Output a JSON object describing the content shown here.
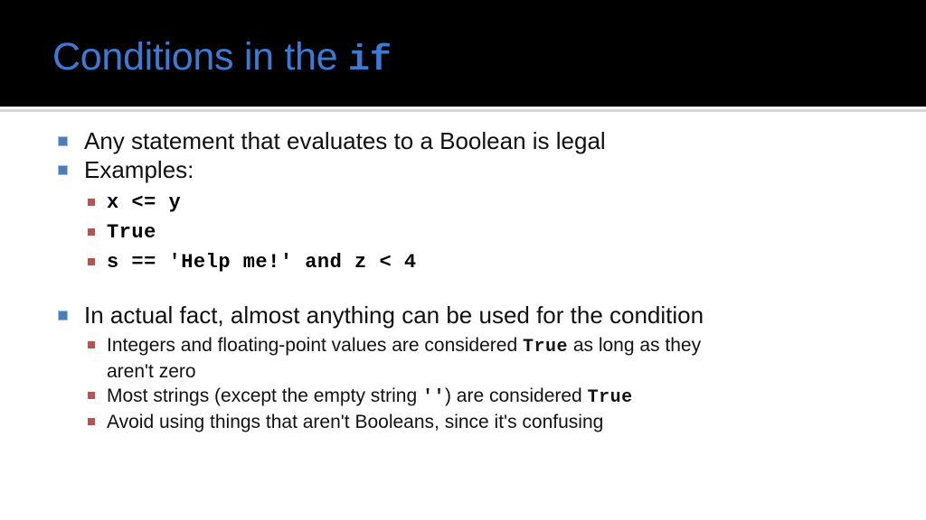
{
  "slide": {
    "title_prefix": "Conditions in the ",
    "title_code": "if",
    "title_color": "#3c7ad4",
    "band_color": "#000000",
    "background_color": "#ffffff",
    "bullet_level1_color": "#4a7ebb",
    "bullet_level2_color": "#b85450"
  },
  "content": {
    "bullet1": "Any statement that evaluates to a Boolean is legal",
    "bullet2": "Examples:",
    "examples": [
      "x <= y",
      "True",
      "s == 'Help me!' and z < 4"
    ],
    "bullet3": "In actual fact, almost anything can be used for the condition",
    "sub1_a": "Integers and floating-point values are considered ",
    "sub1_code": "True",
    "sub1_b": " as long as they",
    "sub1_wrap": "aren't zero",
    "sub2_a": "Most strings (except the empty string ",
    "sub2_code_empty": "''",
    "sub2_b": ") are considered ",
    "sub2_code_true": "True",
    "sub3": "Avoid using things that aren't Booleans, since it's confusing"
  }
}
